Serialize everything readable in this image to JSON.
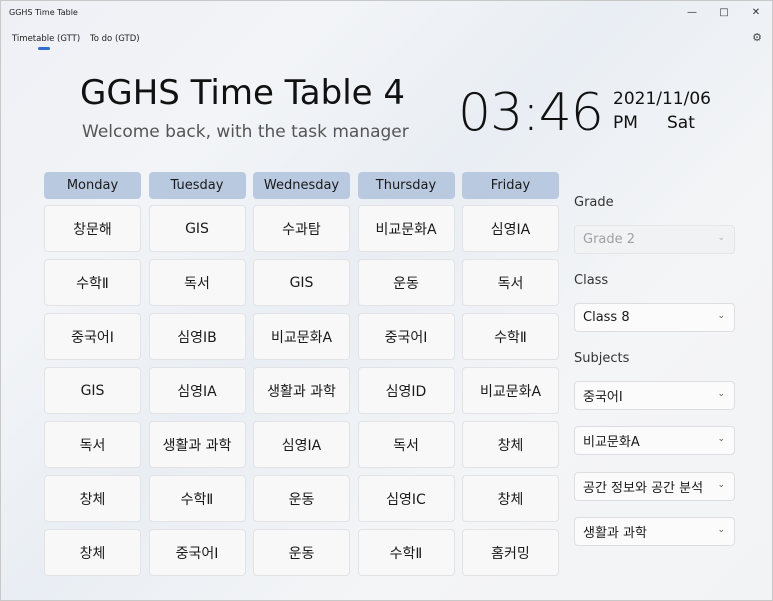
{
  "window": {
    "title": "GGHS Time Table"
  },
  "tabs": [
    {
      "label": "Timetable (GTT)"
    },
    {
      "label": "To do (GTD)"
    }
  ],
  "header": {
    "title": "GGHS Time Table 4",
    "subtitle": "Welcome back, with the task manager",
    "time": "03:46",
    "date": "2021/11/06",
    "ampm": "PM",
    "weekday": "Sat"
  },
  "timetable": {
    "days": [
      "Monday",
      "Tuesday",
      "Wednesday",
      "Thursday",
      "Friday"
    ],
    "rows": [
      [
        "창문해",
        "GIS",
        "수과탐",
        "비교문화A",
        "심영ⅠA"
      ],
      [
        "수학Ⅱ",
        "독서",
        "GIS",
        "운동",
        "독서"
      ],
      [
        "중국어Ⅰ",
        "심영ⅠB",
        "비교문화A",
        "중국어Ⅰ",
        "수학Ⅱ"
      ],
      [
        "GIS",
        "심영ⅠA",
        "생활과 과학",
        "심영ⅠD",
        "비교문화A"
      ],
      [
        "독서",
        "생활과 과학",
        "심영ⅠA",
        "독서",
        "창체"
      ],
      [
        "창체",
        "수학Ⅱ",
        "운동",
        "심영ⅠC",
        "창체"
      ],
      [
        "창체",
        "중국어Ⅰ",
        "운동",
        "수학Ⅱ",
        "홈커밍"
      ]
    ]
  },
  "settings": {
    "grade_label": "Grade",
    "grade_value": "Grade 2",
    "class_label": "Class",
    "class_value": "Class 8",
    "subjects_label": "Subjects",
    "subjects": [
      "중국어Ⅰ",
      "비교문화A",
      "공간 정보와 공간 분석",
      "생활과 과학"
    ]
  },
  "colors": {
    "header_bg": "#b9c9e0",
    "accent": "#2f6fd0"
  }
}
